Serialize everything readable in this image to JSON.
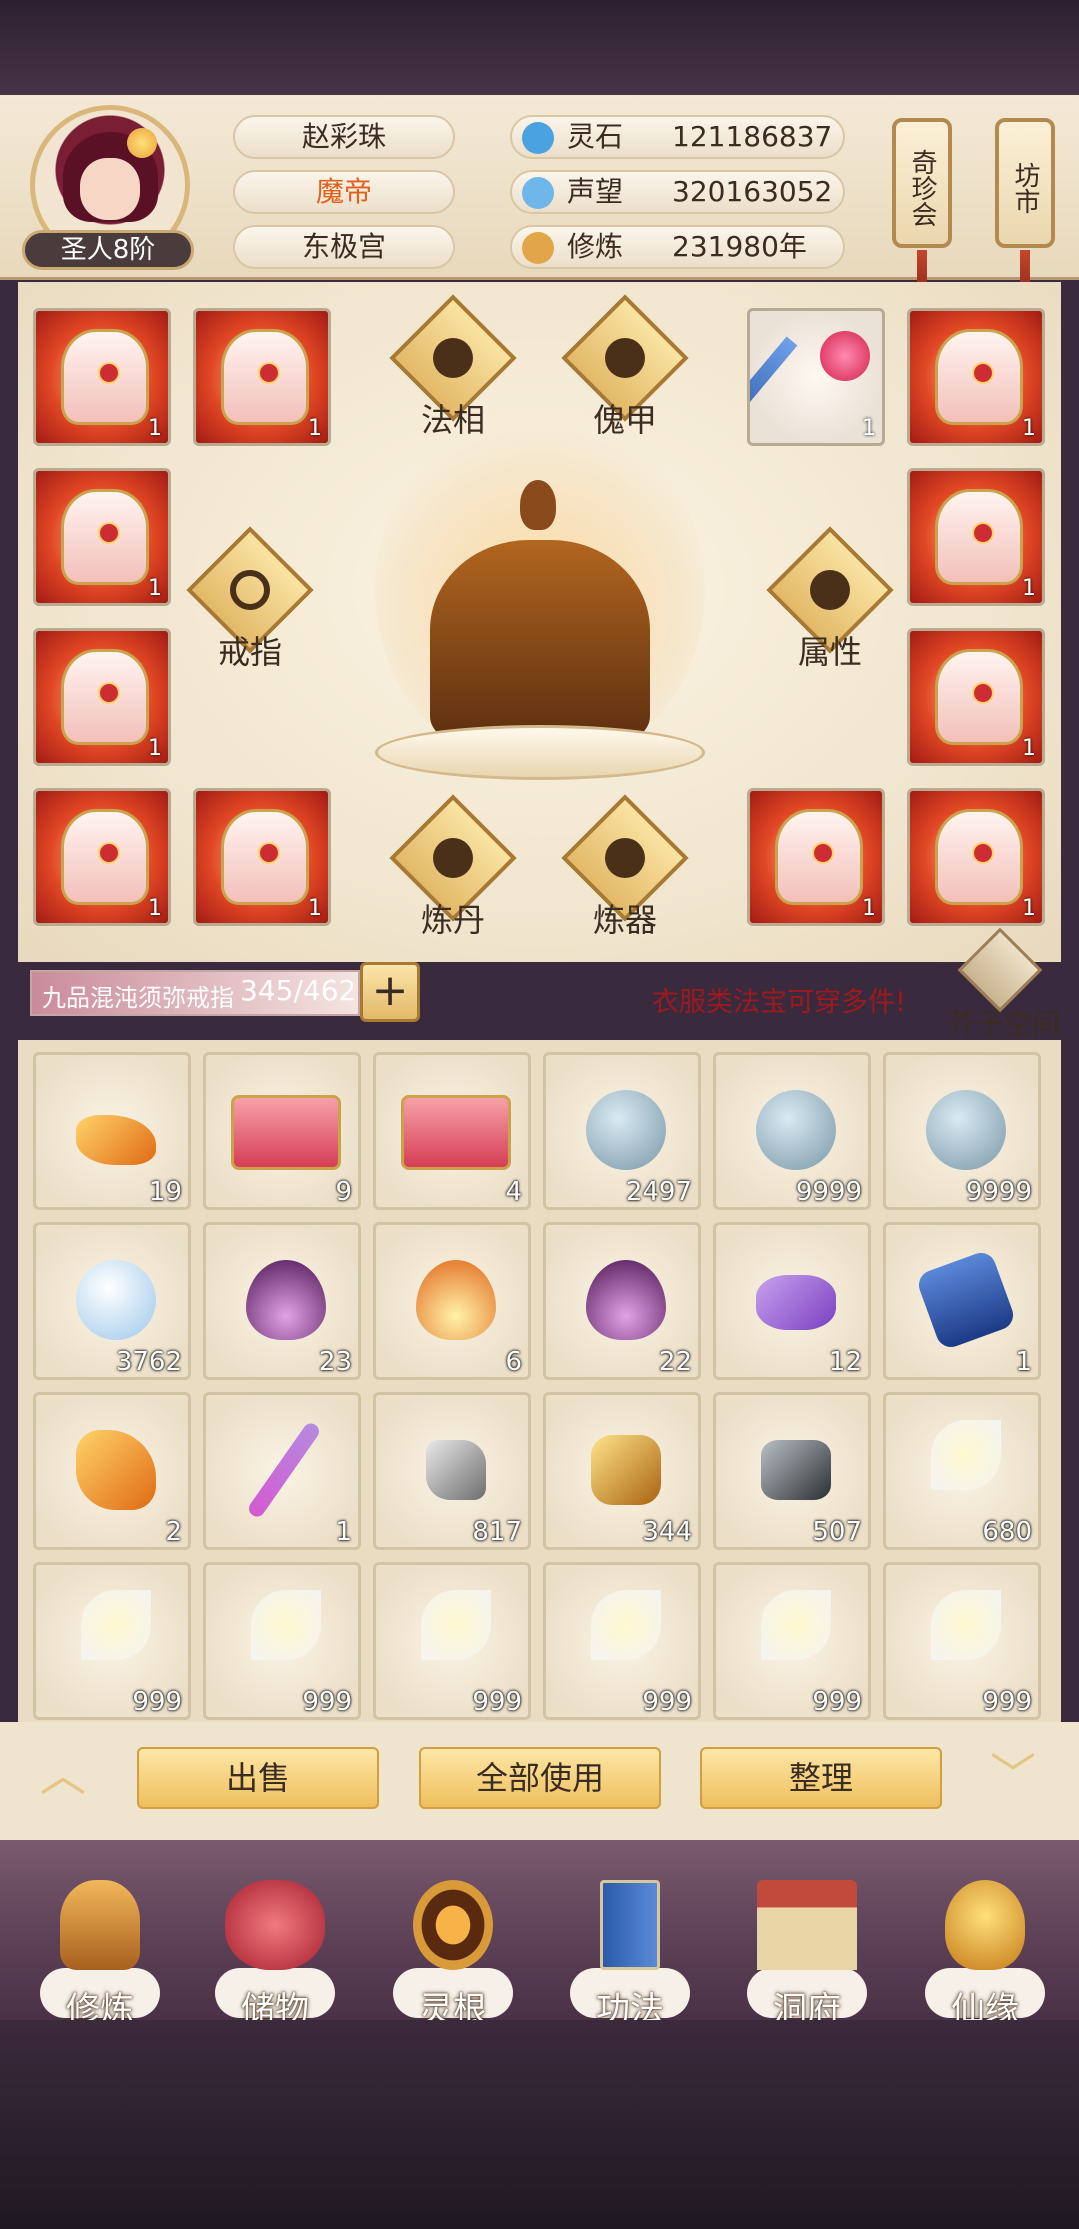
{
  "player": {
    "name": "赵彩珠",
    "title": "魔帝",
    "sect": "东极宫",
    "rank": "圣人8阶"
  },
  "stats": [
    {
      "label": "灵石",
      "value": "121186837",
      "icon": "spirit-stone-icon",
      "color": "#4aa3e0"
    },
    {
      "label": "声望",
      "value": "320163052",
      "icon": "reputation-icon",
      "color": "#6fb7e8"
    },
    {
      "label": "修炼",
      "value": "231980年",
      "icon": "meditation-icon",
      "color": "#e2a54a"
    }
  ],
  "hanging": {
    "treasure": "奇珍会",
    "market": "坊市"
  },
  "equip_labels": {
    "faxiang": "法相",
    "kuijia": "傀甲",
    "ring": "戒指",
    "attr": "属性",
    "alchemy": "炼丹",
    "forge": "炼器"
  },
  "equip_slots": [
    {
      "type": "armor",
      "count": "1"
    },
    {
      "type": "armor",
      "count": "1"
    },
    {
      "type": "sword",
      "count": "1"
    },
    {
      "type": "armor",
      "count": "1"
    },
    {
      "type": "armor",
      "count": "1"
    },
    {
      "type": "armor",
      "count": "1"
    },
    {
      "type": "armor",
      "count": "1"
    },
    {
      "type": "armor",
      "count": "1"
    },
    {
      "type": "armor",
      "count": "1"
    },
    {
      "type": "armor",
      "count": "1"
    },
    {
      "type": "armor",
      "count": "1"
    },
    {
      "type": "armor",
      "count": "1"
    }
  ],
  "bag": {
    "name": "九品混沌须弥戒指",
    "capacity": "345/462",
    "plus": "+",
    "hint": "衣服类法宝可穿多件!",
    "space": "芥子空间"
  },
  "items": [
    {
      "q": "19",
      "kind": "ore-orange"
    },
    {
      "q": "9",
      "kind": "chest"
    },
    {
      "q": "4",
      "kind": "chest"
    },
    {
      "q": "2497",
      "kind": "orb-blue"
    },
    {
      "q": "9999",
      "kind": "orb-blue"
    },
    {
      "q": "9999",
      "kind": "orb-blue"
    },
    {
      "q": "3762",
      "kind": "orb-white"
    },
    {
      "q": "23",
      "kind": "flame-purple"
    },
    {
      "q": "6",
      "kind": "flame-orange"
    },
    {
      "q": "22",
      "kind": "flame-purple"
    },
    {
      "q": "12",
      "kind": "cloud-purple"
    },
    {
      "q": "1",
      "kind": "token-blue"
    },
    {
      "q": "2",
      "kind": "ore-orange"
    },
    {
      "q": "1",
      "kind": "staff"
    },
    {
      "q": "817",
      "kind": "stone-grey"
    },
    {
      "q": "344",
      "kind": "ore-gold"
    },
    {
      "q": "507",
      "kind": "stone-dark"
    },
    {
      "q": "680",
      "kind": "lily"
    },
    {
      "q": "999",
      "kind": "lily"
    },
    {
      "q": "999",
      "kind": "lily"
    },
    {
      "q": "999",
      "kind": "lily"
    },
    {
      "q": "999",
      "kind": "lily"
    },
    {
      "q": "999",
      "kind": "lily"
    },
    {
      "q": "999",
      "kind": "lily"
    }
  ],
  "actions": {
    "sell": "出售",
    "use_all": "全部使用",
    "sort": "整理"
  },
  "nav": [
    {
      "label": "修炼",
      "icon": "cultivation-icon"
    },
    {
      "label": "储物",
      "icon": "storage-bag-icon"
    },
    {
      "label": "灵根",
      "icon": "spirit-root-icon"
    },
    {
      "label": "功法",
      "icon": "technique-book-icon"
    },
    {
      "label": "洞府",
      "icon": "cave-dwelling-icon"
    },
    {
      "label": "仙缘",
      "icon": "immortal-fate-icon"
    }
  ]
}
